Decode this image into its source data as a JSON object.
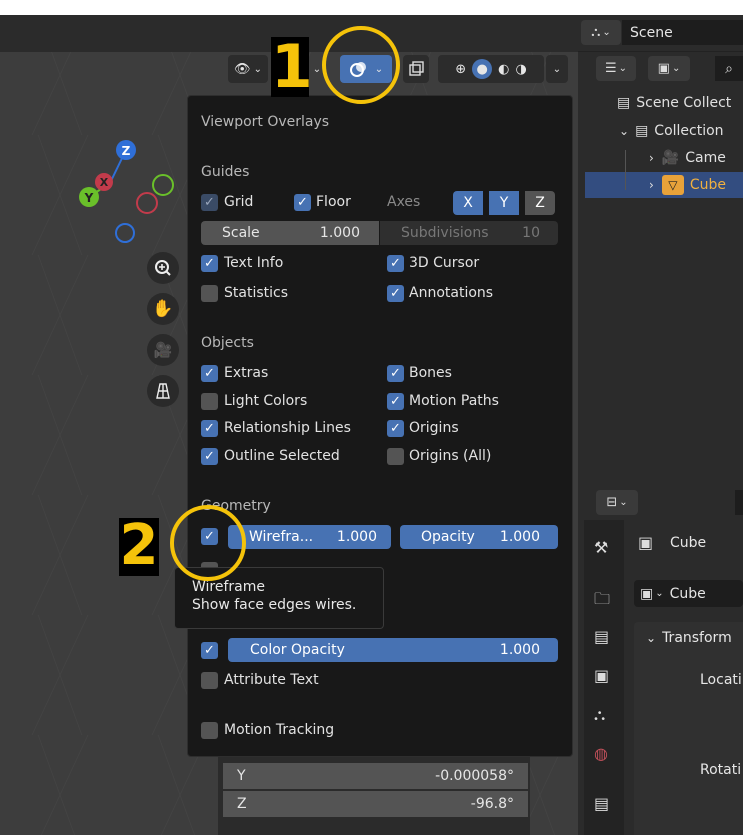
{
  "header": {
    "scene_label": "Scene"
  },
  "outliner": {
    "items": [
      {
        "label": "Scene Collect"
      },
      {
        "label": "Collection"
      },
      {
        "label": "Came"
      },
      {
        "label": "Cube"
      }
    ]
  },
  "properties": {
    "object_name": "Cube",
    "data_name": "Cube",
    "transform_label": "Transform",
    "location_label": "Locati",
    "rotation_label": "Rotati"
  },
  "overlays": {
    "title": "Viewport Overlays",
    "guides": {
      "heading": "Guides",
      "grid": {
        "label": "Grid",
        "checked": true
      },
      "floor": {
        "label": "Floor",
        "checked": true
      },
      "axes_label": "Axes",
      "axes": [
        "X",
        "Y",
        "Z"
      ],
      "scale_label": "Scale",
      "scale_value": "1.000",
      "subdivisions_label": "Subdivisions",
      "subdivisions_value": "10",
      "text_info": {
        "label": "Text Info",
        "checked": true
      },
      "cursor_3d": {
        "label": "3D Cursor",
        "checked": true
      },
      "statistics": {
        "label": "Statistics",
        "checked": false
      },
      "annotations": {
        "label": "Annotations",
        "checked": true
      }
    },
    "objects": {
      "heading": "Objects",
      "extras": {
        "label": "Extras",
        "checked": true
      },
      "bones": {
        "label": "Bones",
        "checked": true
      },
      "light_colors": {
        "label": "Light Colors",
        "checked": false
      },
      "motion_paths": {
        "label": "Motion Paths",
        "checked": true
      },
      "relationship_lines": {
        "label": "Relationship Lines",
        "checked": true
      },
      "origins": {
        "label": "Origins",
        "checked": true
      },
      "outline_selected": {
        "label": "Outline Selected",
        "checked": true
      },
      "origins_all": {
        "label": "Origins (All)",
        "checked": false
      }
    },
    "geometry": {
      "heading": "Geometry",
      "wireframe_label": "Wirefra...",
      "wireframe_value": "1.000",
      "opacity_label": "Opacity",
      "opacity_value": "1.000",
      "color_opacity_label": "Color Opacity",
      "color_opacity_value": "1.000",
      "attribute_text": {
        "label": "Attribute Text",
        "checked": false
      }
    },
    "motion_tracking": {
      "label": "Motion Tracking",
      "checked": false
    }
  },
  "tooltip": {
    "title": "Wireframe",
    "description": "Show face edges wires."
  },
  "rotation_panel": {
    "y_label": "Y",
    "y_value": "-0.000058°",
    "z_label": "Z",
    "z_value": "-96.8°"
  },
  "annotations_markers": {
    "marker1": "1",
    "marker2": "2"
  },
  "colors": {
    "accent": "#4772b3",
    "annotation": "#f5c30a",
    "selected_row": "#334d80",
    "object_orange": "#e8a23a"
  }
}
